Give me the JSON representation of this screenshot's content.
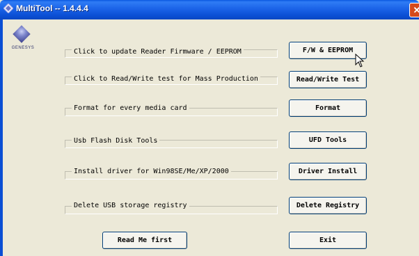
{
  "window": {
    "title": "MultiTool -- 1.4.4.4"
  },
  "logo": {
    "text": "GENESYS"
  },
  "rows": [
    {
      "label": "Click to update Reader Firmware / EEPROM",
      "button": "F/W & EEPROM"
    },
    {
      "label": "Click to Read/Write test for Mass Production",
      "button": "Read/Write Test"
    },
    {
      "label": "Format for every media card",
      "button": "Format"
    },
    {
      "label": "Usb Flash Disk Tools",
      "button": "UFD Tools"
    },
    {
      "label": "Install driver for Win98SE/Me/XP/2000",
      "button": "Driver Install"
    },
    {
      "label": "Delete USB storage registry",
      "button": "Delete Registry"
    }
  ],
  "footer": {
    "readme_label": "Read Me first",
    "exit_label": "Exit"
  },
  "icons": {
    "title": "app-icon",
    "close": "close-icon",
    "cursor": "mouse-pointer-icon"
  }
}
